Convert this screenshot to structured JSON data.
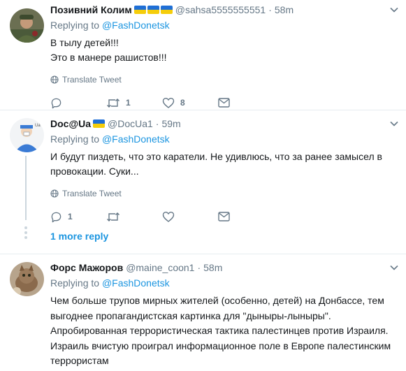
{
  "tweets": [
    {
      "name": "Позивний Колим",
      "flags": 3,
      "handle": "@sahsa5555555551",
      "time": "58m",
      "replying_label": "Replying to",
      "replying_to": "@FashDonetsk",
      "text_lines": [
        "В тылу детей!!!",
        "Это в манере рашистов!!!"
      ],
      "translate": "Translate Tweet",
      "reply_count": "",
      "retweet_count": "1",
      "like_count": "8"
    },
    {
      "name": "Doc@Ua",
      "flags": 1,
      "handle": "@DocUa1",
      "time": "59m",
      "replying_label": "Replying to",
      "replying_to": "@FashDonetsk",
      "text_lines": [
        "И будут пиздеть, что это каратели. Не удивлюсь, что за ранее замысел в",
        "провокации. Суки..."
      ],
      "translate": "Translate Tweet",
      "reply_count": "1",
      "retweet_count": "",
      "like_count": "",
      "more_replies": "1 more reply"
    },
    {
      "name": "Форс Мажоров",
      "flags": 0,
      "handle": "@maine_coon1",
      "time": "58m",
      "replying_label": "Replying to",
      "replying_to": "@FashDonetsk",
      "text_lines": [
        "Чем больше трупов мирных жителей (особенно, детей) на Донбассе, тем",
        "выгоднее пропагандистская картинка для \"дыныры-лыныры\".",
        "Апробированная террористическая тактика палестинцев против Израиля.",
        "Израиль вчистую проиграл информационное поле в Европе палестинским",
        "террористам"
      ]
    }
  ],
  "colors": {
    "link": "#1b95e0",
    "secondary": "#657786",
    "border": "#e6ecf0"
  }
}
